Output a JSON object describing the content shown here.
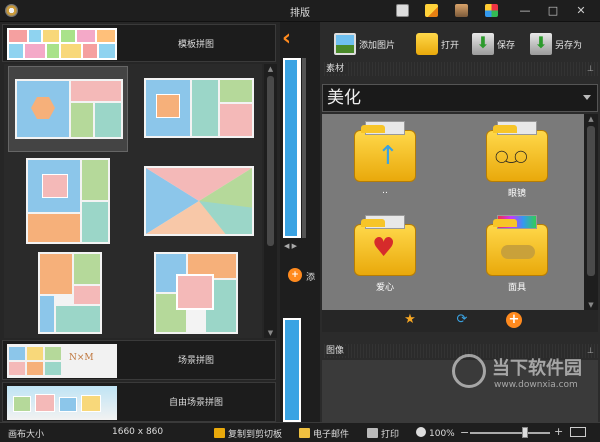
{
  "window": {
    "title": "排版"
  },
  "left": {
    "template_section": {
      "label": "模板拼图"
    },
    "scene_section": {
      "label": "场景拼图",
      "thumb_text": "Ν×Μ"
    },
    "free_section": {
      "label": "自由场景拼图"
    }
  },
  "right": {
    "toolbar": {
      "add_image": "添加图片",
      "open": "打开",
      "save": "保存",
      "save_as": "另存为"
    },
    "material": {
      "title": "素材",
      "combo_value": "美化",
      "folders": [
        {
          "label": ".."
        },
        {
          "label": "眼镜"
        },
        {
          "label": "爱心"
        },
        {
          "label": "面具"
        }
      ]
    },
    "image_panel": {
      "title": "图像"
    }
  },
  "middle": {
    "add_label": "添"
  },
  "status": {
    "canvas_label": "画布大小",
    "canvas_size": "1660 x 860",
    "copy": "复制到剪切板",
    "email": "电子邮件",
    "print": "打印",
    "zoom": "100%"
  },
  "watermark": {
    "brand": "当下软件园",
    "url": "www.downxia.com"
  },
  "colors": {
    "accent": "#3aa3e3",
    "orange": "#ff8a1e",
    "star": "#f5a623"
  }
}
